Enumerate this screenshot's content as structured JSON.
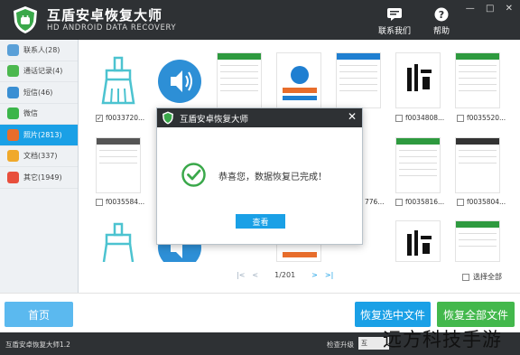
{
  "header": {
    "title": "互盾安卓恢复大师",
    "subtitle": "HD ANDROID DATA RECOVERY",
    "contact_label": "联系我们",
    "help_label": "帮助",
    "window_controls": [
      "—",
      "□",
      "✕"
    ]
  },
  "sidebar": {
    "items": [
      {
        "label": "联系人(28)",
        "icon": "contacts-icon",
        "color": "#5aa0d8"
      },
      {
        "label": "通话记录(4)",
        "icon": "phone-icon",
        "color": "#4cb84f"
      },
      {
        "label": "短信(46)",
        "icon": "sms-icon",
        "color": "#3a8fd3"
      },
      {
        "label": "微信",
        "icon": "wechat-icon",
        "color": "#3bb54a"
      },
      {
        "label": "照片(2813)",
        "icon": "photo-icon",
        "color": "#e86d2b",
        "active": true
      },
      {
        "label": "文档(337)",
        "icon": "document-icon",
        "color": "#f0a92b"
      },
      {
        "label": "其它(1949)",
        "icon": "other-icon",
        "color": "#e84f3c"
      }
    ]
  },
  "grid": {
    "captions": [
      "f0033720...",
      "f0034808...",
      "f0035520...",
      "f0035584...",
      "776...",
      "f0035816...",
      "f0035804..."
    ]
  },
  "pager": {
    "first": "|<",
    "prev": "<",
    "page": "1/201",
    "next": ">",
    "last": ">|"
  },
  "select_all_label": "选择全部",
  "buttons": {
    "home": "首页",
    "recover_selected": "恢复选中文件",
    "recover_all": "恢复全部文件"
  },
  "modal": {
    "title": "互盾安卓恢复大师",
    "close": "✕",
    "message": "恭喜您，数据恢复已完成！",
    "view_button": "查看"
  },
  "status": {
    "version": "互盾安卓恢复大师1.2",
    "check_update": "检查升级",
    "box_text": "互"
  },
  "watermark": "远方科技手游",
  "colors": {
    "header_bg": "#2e3134",
    "accent_blue": "#1aa0e6",
    "accent_green": "#43b84c"
  }
}
